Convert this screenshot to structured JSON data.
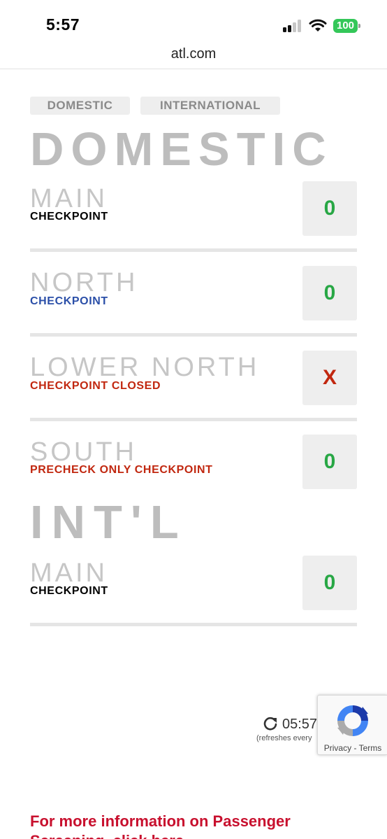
{
  "status_bar": {
    "time": "5:57",
    "battery": "100"
  },
  "browser": {
    "url": "atl.com"
  },
  "tabs": [
    {
      "label": "DOMESTIC"
    },
    {
      "label": "INTERNATIONAL"
    }
  ],
  "domestic": {
    "heading": "DOMESTIC",
    "checkpoints": [
      {
        "name": "MAIN",
        "subtitle": "CHECKPOINT",
        "subtitle_color": "#000000",
        "wait": "0",
        "wait_color": "#28a745"
      },
      {
        "name": "NORTH",
        "subtitle": "CHECKPOINT",
        "subtitle_color": "#2b4fa8",
        "wait": "0",
        "wait_color": "#28a745"
      },
      {
        "name": "LOWER NORTH",
        "subtitle": "CHECKPOINT CLOSED",
        "subtitle_color": "#c1270f",
        "wait": "X",
        "wait_color": "#c1270f"
      },
      {
        "name": "SOUTH",
        "subtitle": "PRECHECK ONLY CHECKPOINT",
        "subtitle_color": "#c1270f",
        "wait": "0",
        "wait_color": "#28a745"
      }
    ]
  },
  "international": {
    "heading": "INT'L",
    "checkpoints": [
      {
        "name": "MAIN",
        "subtitle": "CHECKPOINT",
        "subtitle_color": "#000000",
        "wait": "0",
        "wait_color": "#28a745"
      }
    ]
  },
  "refresh": {
    "time": "05:57",
    "note": "(refreshes every"
  },
  "recaptcha": {
    "privacy": "Privacy",
    "separator": " - ",
    "terms": "Terms"
  },
  "footer": {
    "link_text": "For more information on Passenger Screening, click here"
  }
}
